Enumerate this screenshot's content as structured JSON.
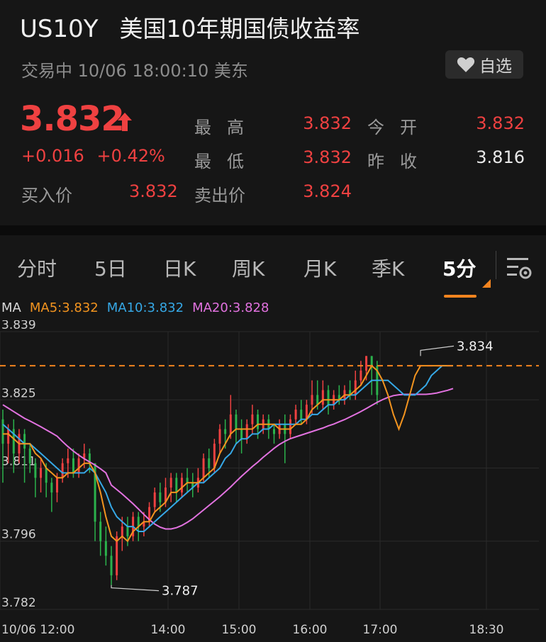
{
  "header": {
    "ticker": "US10Y",
    "title": "美国10年期国债收益率",
    "status": "交易中 10/06 18:00:10 美东",
    "fav_label": "自选"
  },
  "quote": {
    "price": "3.832",
    "change": "+0.016",
    "change_pct": "+0.42%",
    "bid_label": "买入价",
    "bid": "3.832",
    "ask_label": "卖出价",
    "ask": "3.824",
    "high_label": "最高",
    "high": "3.832",
    "low_label": "最低",
    "low": "3.832",
    "open_label": "今开",
    "open": "3.832",
    "prev_close_label": "昨收",
    "prev_close": "3.816"
  },
  "tabs": [
    "分时",
    "5日",
    "日K",
    "周K",
    "月K",
    "季K",
    "5分"
  ],
  "active_tab": "5分",
  "ma": {
    "label": "MA",
    "ma5": "MA5:3.832",
    "ma10": "MA10:3.832",
    "ma20": "MA20:3.828"
  },
  "colors": {
    "up": "#ef4141",
    "down": "#2bb24c",
    "ma5": "#f3941f",
    "ma10": "#36a8e6",
    "ma20": "#e272e0",
    "accent": "#f3841f"
  },
  "chart_data": {
    "type": "candlestick",
    "y_ticks": [
      "3.839",
      "3.825",
      "3.811",
      "3.796",
      "3.782"
    ],
    "ylim": [
      3.782,
      3.839
    ],
    "x_ticks": [
      "10/06 12:00",
      "14:00",
      "15:00",
      "16:00",
      "17:00",
      "18:30"
    ],
    "current_line": 3.832,
    "annotations": [
      {
        "label": "3.834",
        "value": 3.834,
        "type": "high"
      },
      {
        "label": "3.787",
        "value": 3.787,
        "type": "low"
      }
    ],
    "candles": [
      [
        3.821,
        3.816,
        3.823,
        3.808
      ],
      [
        3.816,
        3.819,
        3.82,
        3.812
      ],
      [
        3.819,
        3.814,
        3.821,
        3.81
      ],
      [
        3.814,
        3.818,
        3.819,
        3.812
      ],
      [
        3.818,
        3.815,
        3.819,
        3.808
      ],
      [
        3.815,
        3.812,
        3.816,
        3.81
      ],
      [
        3.812,
        3.809,
        3.813,
        3.805
      ],
      [
        3.809,
        3.811,
        3.813,
        3.806
      ],
      [
        3.811,
        3.808,
        3.812,
        3.805
      ],
      [
        3.808,
        3.806,
        3.809,
        3.802
      ],
      [
        3.806,
        3.809,
        3.81,
        3.804
      ],
      [
        3.809,
        3.812,
        3.813,
        3.808
      ],
      [
        3.812,
        3.813,
        3.815,
        3.809
      ],
      [
        3.813,
        3.81,
        3.815,
        3.809
      ],
      [
        3.81,
        3.813,
        3.814,
        3.809
      ],
      [
        3.813,
        3.814,
        3.816,
        3.811
      ],
      [
        3.814,
        3.812,
        3.815,
        3.81
      ],
      [
        3.812,
        3.8,
        3.812,
        3.796
      ],
      [
        3.8,
        3.796,
        3.802,
        3.793
      ],
      [
        3.796,
        3.793,
        3.799,
        3.791
      ],
      [
        3.793,
        3.789,
        3.795,
        3.787
      ],
      [
        3.789,
        3.797,
        3.798,
        3.788
      ],
      [
        3.797,
        3.799,
        3.801,
        3.794
      ],
      [
        3.799,
        3.797,
        3.801,
        3.795
      ],
      [
        3.797,
        3.801,
        3.802,
        3.796
      ],
      [
        3.801,
        3.799,
        3.802,
        3.796
      ],
      [
        3.799,
        3.8,
        3.802,
        3.797
      ],
      [
        3.8,
        3.803,
        3.804,
        3.799
      ],
      [
        3.803,
        3.806,
        3.807,
        3.802
      ],
      [
        3.806,
        3.804,
        3.808,
        3.802
      ],
      [
        3.804,
        3.807,
        3.809,
        3.803
      ],
      [
        3.807,
        3.809,
        3.81,
        3.804
      ],
      [
        3.809,
        3.806,
        3.81,
        3.804
      ],
      [
        3.806,
        3.809,
        3.81,
        3.805
      ],
      [
        3.809,
        3.808,
        3.811,
        3.806
      ],
      [
        3.808,
        3.807,
        3.81,
        3.805
      ],
      [
        3.807,
        3.809,
        3.811,
        3.806
      ],
      [
        3.809,
        3.813,
        3.814,
        3.808
      ],
      [
        3.813,
        3.811,
        3.815,
        3.809
      ],
      [
        3.811,
        3.816,
        3.817,
        3.81
      ],
      [
        3.816,
        3.819,
        3.82,
        3.814
      ],
      [
        3.819,
        3.818,
        3.821,
        3.815
      ],
      [
        3.818,
        3.822,
        3.826,
        3.817
      ],
      [
        3.822,
        3.819,
        3.823,
        3.816
      ],
      [
        3.819,
        3.817,
        3.821,
        3.814
      ],
      [
        3.817,
        3.82,
        3.821,
        3.816
      ],
      [
        3.82,
        3.822,
        3.824,
        3.818
      ],
      [
        3.822,
        3.819,
        3.823,
        3.817
      ],
      [
        3.819,
        3.821,
        3.822,
        3.818
      ],
      [
        3.821,
        3.819,
        3.822,
        3.817
      ],
      [
        3.819,
        3.818,
        3.82,
        3.816
      ],
      [
        3.818,
        3.82,
        3.821,
        3.817
      ],
      [
        3.82,
        3.818,
        3.822,
        3.812
      ],
      [
        3.818,
        3.821,
        3.822,
        3.817
      ],
      [
        3.821,
        3.823,
        3.824,
        3.82
      ],
      [
        3.823,
        3.821,
        3.825,
        3.82
      ],
      [
        3.821,
        3.824,
        3.825,
        3.82
      ],
      [
        3.824,
        3.826,
        3.829,
        3.822
      ],
      [
        3.826,
        3.824,
        3.829,
        3.823
      ],
      [
        3.824,
        3.827,
        3.829,
        3.823
      ],
      [
        3.827,
        3.824,
        3.828,
        3.822
      ],
      [
        3.824,
        3.826,
        3.827,
        3.823
      ],
      [
        3.826,
        3.825,
        3.828,
        3.824
      ],
      [
        3.825,
        3.827,
        3.828,
        3.824
      ],
      [
        3.827,
        3.826,
        3.829,
        3.825
      ],
      [
        3.826,
        3.829,
        3.831,
        3.825
      ],
      [
        3.829,
        3.831,
        3.833,
        3.828
      ],
      [
        3.831,
        3.834,
        3.834,
        3.829
      ],
      [
        3.834,
        3.832,
        3.834,
        3.826
      ],
      [
        3.832,
        3.826,
        3.833,
        3.824
      ]
    ],
    "ma5": [
      3.818,
      3.818,
      3.817,
      3.816,
      3.816,
      3.816,
      3.814,
      3.813,
      3.811,
      3.81,
      3.809,
      3.809,
      3.81,
      3.81,
      3.811,
      3.812,
      3.812,
      3.81,
      3.806,
      3.801,
      3.797,
      3.796,
      3.797,
      3.796,
      3.798,
      3.799,
      3.8,
      3.8,
      3.802,
      3.803,
      3.804,
      3.806,
      3.806,
      3.807,
      3.808,
      3.808,
      3.808,
      3.809,
      3.81,
      3.811,
      3.814,
      3.816,
      3.818,
      3.819,
      3.819,
      3.819,
      3.819,
      3.82,
      3.82,
      3.82,
      3.82,
      3.819,
      3.819,
      3.819,
      3.82,
      3.82,
      3.821,
      3.823,
      3.824,
      3.825,
      3.825,
      3.825,
      3.825,
      3.826,
      3.826,
      3.827,
      3.828,
      3.83,
      3.832,
      3.831,
      3.829,
      3.826,
      3.822,
      3.819,
      3.822,
      3.826,
      3.83,
      3.832,
      3.832,
      3.832,
      3.832,
      3.832,
      3.832,
      3.832
    ],
    "ma10": [
      3.82,
      3.819,
      3.818,
      3.817,
      3.816,
      3.816,
      3.815,
      3.814,
      3.813,
      3.812,
      3.811,
      3.81,
      3.81,
      3.81,
      3.81,
      3.81,
      3.811,
      3.81,
      3.808,
      3.806,
      3.803,
      3.801,
      3.8,
      3.799,
      3.799,
      3.798,
      3.798,
      3.799,
      3.8,
      3.801,
      3.802,
      3.803,
      3.804,
      3.805,
      3.806,
      3.807,
      3.808,
      3.808,
      3.809,
      3.81,
      3.811,
      3.813,
      3.814,
      3.816,
      3.817,
      3.817,
      3.818,
      3.818,
      3.819,
      3.819,
      3.82,
      3.82,
      3.82,
      3.82,
      3.82,
      3.821,
      3.821,
      3.822,
      3.822,
      3.823,
      3.824,
      3.824,
      3.825,
      3.825,
      3.826,
      3.826,
      3.827,
      3.828,
      3.829,
      3.829,
      3.829,
      3.829,
      3.828,
      3.827,
      3.826,
      3.826,
      3.826,
      3.827,
      3.828,
      3.83,
      3.831,
      3.832,
      3.832,
      3.832
    ]
  }
}
